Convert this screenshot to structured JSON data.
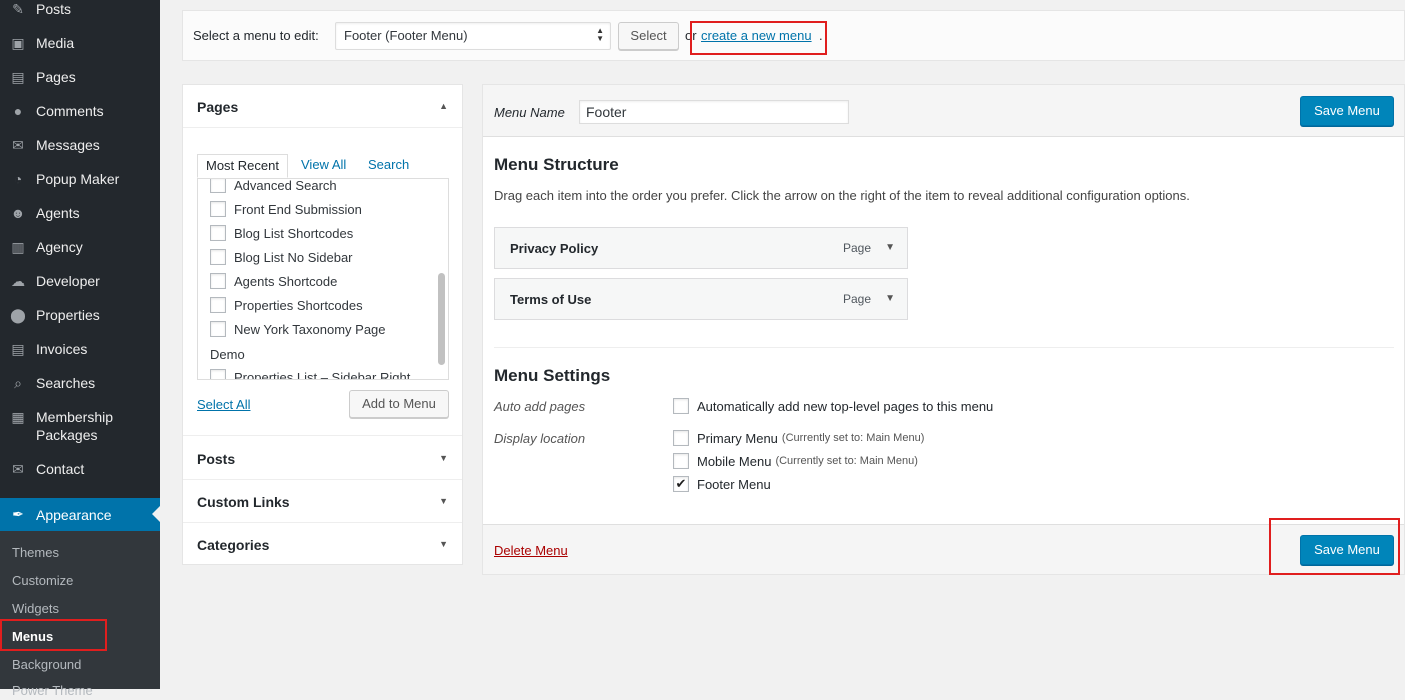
{
  "sidebar": {
    "items": [
      {
        "label": "Posts",
        "icon": "pin-icon",
        "glyph": "✎"
      },
      {
        "label": "Media",
        "icon": "media-icon",
        "glyph": "▣"
      },
      {
        "label": "Pages",
        "icon": "page-icon",
        "glyph": "▤"
      },
      {
        "label": "Comments",
        "icon": "comment-icon",
        "glyph": "●"
      },
      {
        "label": "Messages",
        "icon": "envelope-icon",
        "glyph": "✉"
      },
      {
        "label": "Popup Maker",
        "icon": "popup-icon",
        "glyph": "◔"
      },
      {
        "label": "Agents",
        "icon": "users-icon",
        "glyph": "☻"
      },
      {
        "label": "Agency",
        "icon": "building-icon",
        "glyph": "▥"
      },
      {
        "label": "Developer",
        "icon": "cloud-icon",
        "glyph": "☁"
      },
      {
        "label": "Properties",
        "icon": "location-pin-icon",
        "glyph": "⬤"
      },
      {
        "label": "Invoices",
        "icon": "invoice-icon",
        "glyph": "▤"
      },
      {
        "label": "Searches",
        "icon": "search-icon",
        "glyph": "⌕"
      },
      {
        "label": "Membership Packages",
        "icon": "calendar-icon",
        "glyph": "▦"
      },
      {
        "label": "Contact",
        "icon": "mail-icon",
        "glyph": "✉"
      }
    ],
    "appearance": {
      "label": "Appearance",
      "icon": "paintbrush-icon",
      "glyph": "✒"
    },
    "submenu": [
      "Themes",
      "Customize",
      "Widgets",
      "Menus",
      "Background",
      "Power Theme"
    ],
    "submenu_current": "Menus"
  },
  "manage": {
    "label": "Select a menu to edit:",
    "selected_menu": "Footer (Footer Menu)",
    "select_button": "Select",
    "or_text": "or",
    "create_link": "create a new menu",
    "create_suffix": "."
  },
  "accordion": {
    "pages_title": "Pages",
    "tabs": [
      "Most Recent",
      "View All",
      "Search"
    ],
    "list_items": [
      "Advanced Search",
      "Front End Submission",
      "Blog List Shortcodes",
      "Blog List No Sidebar",
      "Agents Shortcode",
      "Properties Shortcodes",
      "New York Taxonomy Page"
    ],
    "group_label": "Demo",
    "partial_item": "Properties List – Sidebar Right",
    "select_all": "Select All",
    "add_button": "Add to Menu",
    "sections": [
      "Posts",
      "Custom Links",
      "Categories"
    ]
  },
  "menu_edit": {
    "name_label": "Menu Name",
    "name_value": "Footer",
    "save_button": "Save Menu",
    "structure_title": "Menu Structure",
    "structure_desc": "Drag each item into the order you prefer. Click the arrow on the right of the item to reveal additional configuration options.",
    "entries": [
      {
        "title": "Privacy Policy",
        "type": "Page"
      },
      {
        "title": "Terms of Use",
        "type": "Page"
      }
    ],
    "settings_title": "Menu Settings",
    "auto_add_label": "Auto add pages",
    "auto_add_option": "Automatically add new top-level pages to this menu",
    "display_label": "Display location",
    "locations": [
      {
        "name": "Primary Menu",
        "note": "(Currently set to: Main Menu)",
        "checked": false
      },
      {
        "name": "Mobile Menu",
        "note": "(Currently set to: Main Menu)",
        "checked": false
      },
      {
        "name": "Footer Menu",
        "note": "",
        "checked": true
      }
    ],
    "delete_link": "Delete Menu"
  },
  "colors": {
    "accent": "#0073aa",
    "highlight": "#e01e1e",
    "sidebar": "#23282d"
  }
}
